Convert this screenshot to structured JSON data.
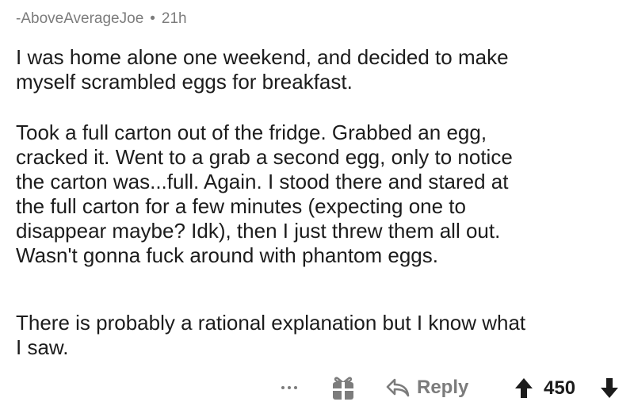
{
  "comment": {
    "author": "-AboveAverageJoe",
    "separator": "•",
    "age": "21h",
    "paragraphs": [
      "I was home alone one weekend, and decided to make\nmyself scrambled eggs for breakfast.",
      "Took a full carton out of the fridge. Grabbed an egg,\ncracked it. Went to a grab a second egg, only to notice\nthe carton was...full. Again. I stood there and stared at\nthe full carton for a few minutes (expecting one to\ndisappear maybe? Idk), then I just threw them all out.\nWasn't gonna fuck around with phantom eggs.",
      "There is probably a rational explanation but I know what\nI saw."
    ]
  },
  "actions": {
    "more_icon": "ellipsis-icon",
    "award_icon": "gift-icon",
    "reply_icon": "reply-arrow-icon",
    "reply_label": "Reply",
    "upvote_icon": "up-arrow-icon",
    "score": "450",
    "downvote_icon": "down-arrow-icon"
  },
  "colors": {
    "text": "#1c1c1c",
    "meta": "#7c7c7c",
    "icon": "#7c7c7c",
    "background": "#ffffff"
  }
}
